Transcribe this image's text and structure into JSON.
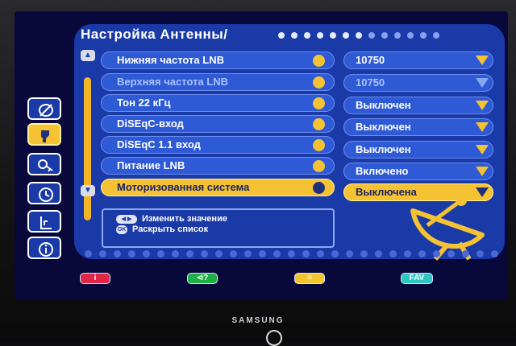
{
  "menu": {
    "title": "Настройка Антенны/",
    "rows": [
      {
        "label": "Нижняя частота LNB",
        "value": "10750",
        "state": "normal"
      },
      {
        "label": "Верхняя частота LNB",
        "value": "10750",
        "state": "dim"
      },
      {
        "label": "Тон 22 кГц",
        "value": "Выключен",
        "state": "normal"
      },
      {
        "label": "DiSEqC-вход",
        "value": "Выключен",
        "state": "normal"
      },
      {
        "label": "DiSEqC 1.1 вход",
        "value": "Выключен",
        "state": "normal"
      },
      {
        "label": "Питание LNB",
        "value": "Включено",
        "state": "normal"
      },
      {
        "label": "Моторизованная система",
        "value": "Выключена",
        "state": "selected"
      }
    ]
  },
  "help": {
    "change_value": "Изменить значение",
    "open_list": "Раскрыть список",
    "ok_key": "OK"
  },
  "sidebar": {
    "icons": [
      "satellite-off-icon",
      "antenna-settings-icon",
      "key-icon",
      "clock-icon",
      "chart-icon",
      "info-icon"
    ],
    "selected_index": 1
  },
  "buttons": {
    "red": "i",
    "green": "⊲?",
    "yellow": "≡",
    "blue": "FAV"
  },
  "tv": {
    "brand": "SAMSUNG"
  },
  "colors": {
    "panel": "#1a3aa8",
    "row": "#2f5ad6",
    "accent": "#f5c233",
    "text": "#ffffff"
  }
}
